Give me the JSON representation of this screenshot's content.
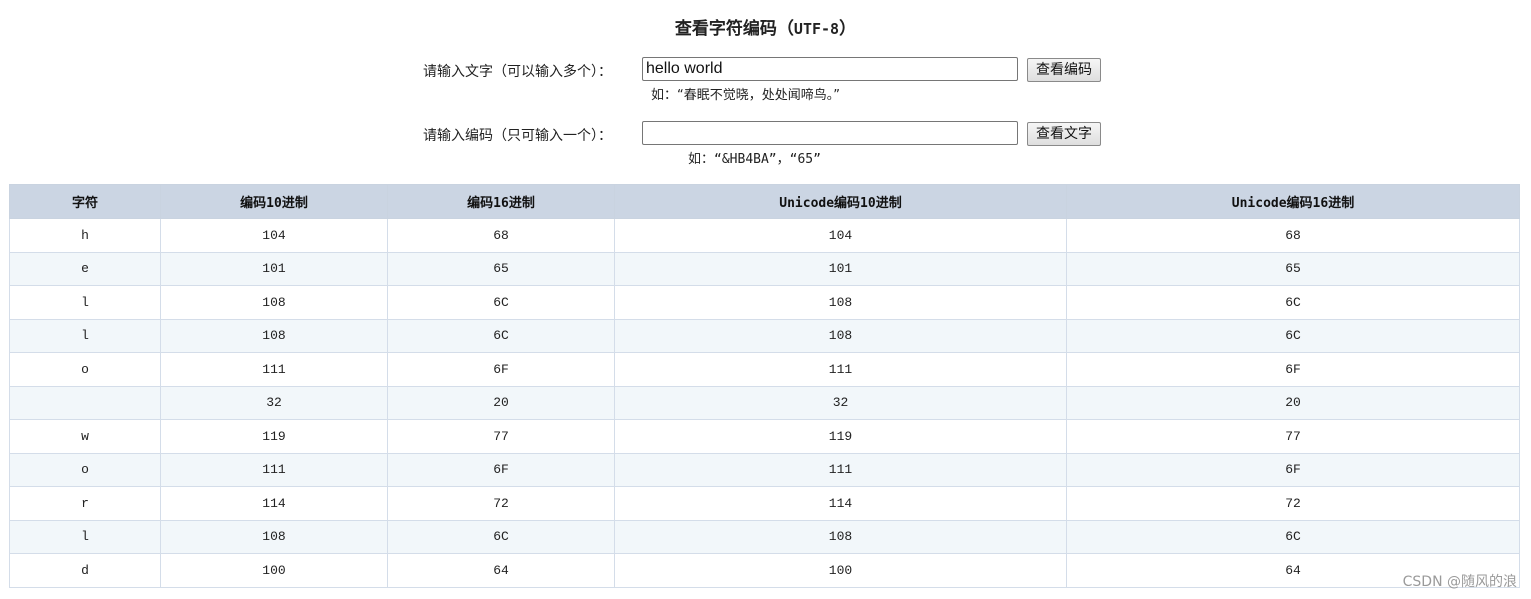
{
  "title": {
    "cn": "查看字符编码（",
    "code": "UTF-8",
    "close": "）"
  },
  "text_row": {
    "label": "请输入文字（可以输入多个）：",
    "value": "hello world",
    "button": "查看编码",
    "hint_prefix": "如：",
    "hint_example": "“春眠不觉晓，处处闻啼鸟。”"
  },
  "code_row": {
    "label": "请输入编码（只可输入一个）：",
    "value": "",
    "button": "查看文字",
    "hint_prefix": "如：",
    "hint_example": "“&HB4BA”，“65”"
  },
  "table": {
    "headers": [
      "字符",
      "编码10进制",
      "编码16进制",
      "Unicode编码10进制",
      "Unicode编码16进制"
    ],
    "rows": [
      [
        "h",
        "104",
        "68",
        "104",
        "68"
      ],
      [
        "e",
        "101",
        "65",
        "101",
        "65"
      ],
      [
        "l",
        "108",
        "6C",
        "108",
        "6C"
      ],
      [
        "l",
        "108",
        "6C",
        "108",
        "6C"
      ],
      [
        "o",
        "111",
        "6F",
        "111",
        "6F"
      ],
      [
        " ",
        "32",
        "20",
        "32",
        "20"
      ],
      [
        "w",
        "119",
        "77",
        "119",
        "77"
      ],
      [
        "o",
        "111",
        "6F",
        "111",
        "6F"
      ],
      [
        "r",
        "114",
        "72",
        "114",
        "72"
      ],
      [
        "l",
        "108",
        "6C",
        "108",
        "6C"
      ],
      [
        "d",
        "100",
        "64",
        "100",
        "64"
      ]
    ]
  },
  "watermark": "CSDN @随风的浪",
  "colors": {
    "header_bg": "#cbd5e3",
    "alt_row_bg": "#f2f7fa",
    "border": "#d4dde9"
  }
}
